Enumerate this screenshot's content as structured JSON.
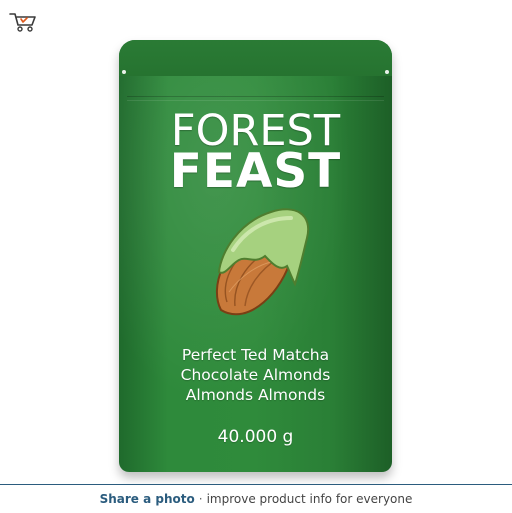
{
  "header": {
    "cart_icon": "shopping-cart-icon"
  },
  "product": {
    "brand_line1": "FOREST",
    "brand_line2": "FEAST",
    "description_lines": [
      "Perfect Ted Matcha",
      "Chocolate Almonds",
      "Almonds Almonds"
    ],
    "weight": "40.000 g"
  },
  "footer": {
    "share_link": "Share a photo",
    "separator": "·",
    "message": "improve product info for everyone"
  },
  "colors": {
    "pouch_green": "#2e8a3b",
    "link_blue": "#2b5c7e",
    "matcha": "#a6d17f",
    "almond": "#c57a3c"
  }
}
